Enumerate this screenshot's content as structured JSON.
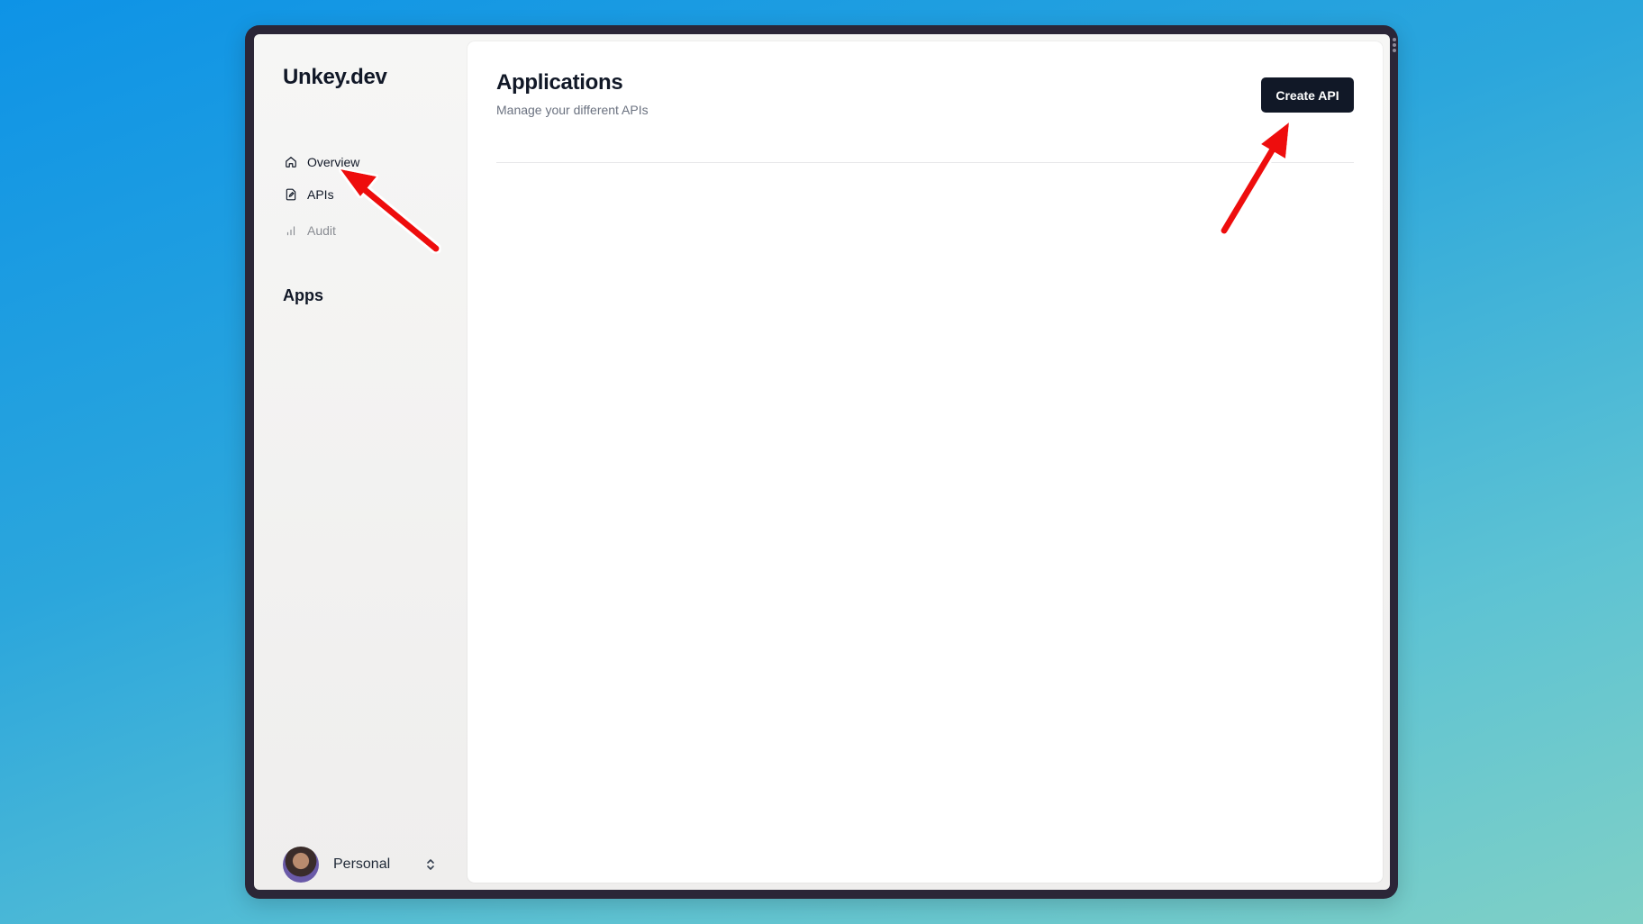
{
  "sidebar": {
    "logo": "Unkey.dev",
    "nav": [
      {
        "label": "Overview",
        "icon": "home-icon"
      },
      {
        "label": "APIs",
        "icon": "file-edit-icon"
      },
      {
        "label": "Audit",
        "icon": "bar-chart-icon",
        "disabled": true
      }
    ],
    "section_title": "Apps",
    "account": {
      "name": "Personal",
      "icon": "chevrons-up-down-icon"
    }
  },
  "main": {
    "title": "Applications",
    "subtitle": "Manage your different APIs",
    "create_button": "Create API"
  },
  "colors": {
    "accent": "#111827",
    "annotation_arrow": "#ee1111",
    "background_top": "#0e93e6",
    "background_bottom": "#7fd0c6"
  }
}
